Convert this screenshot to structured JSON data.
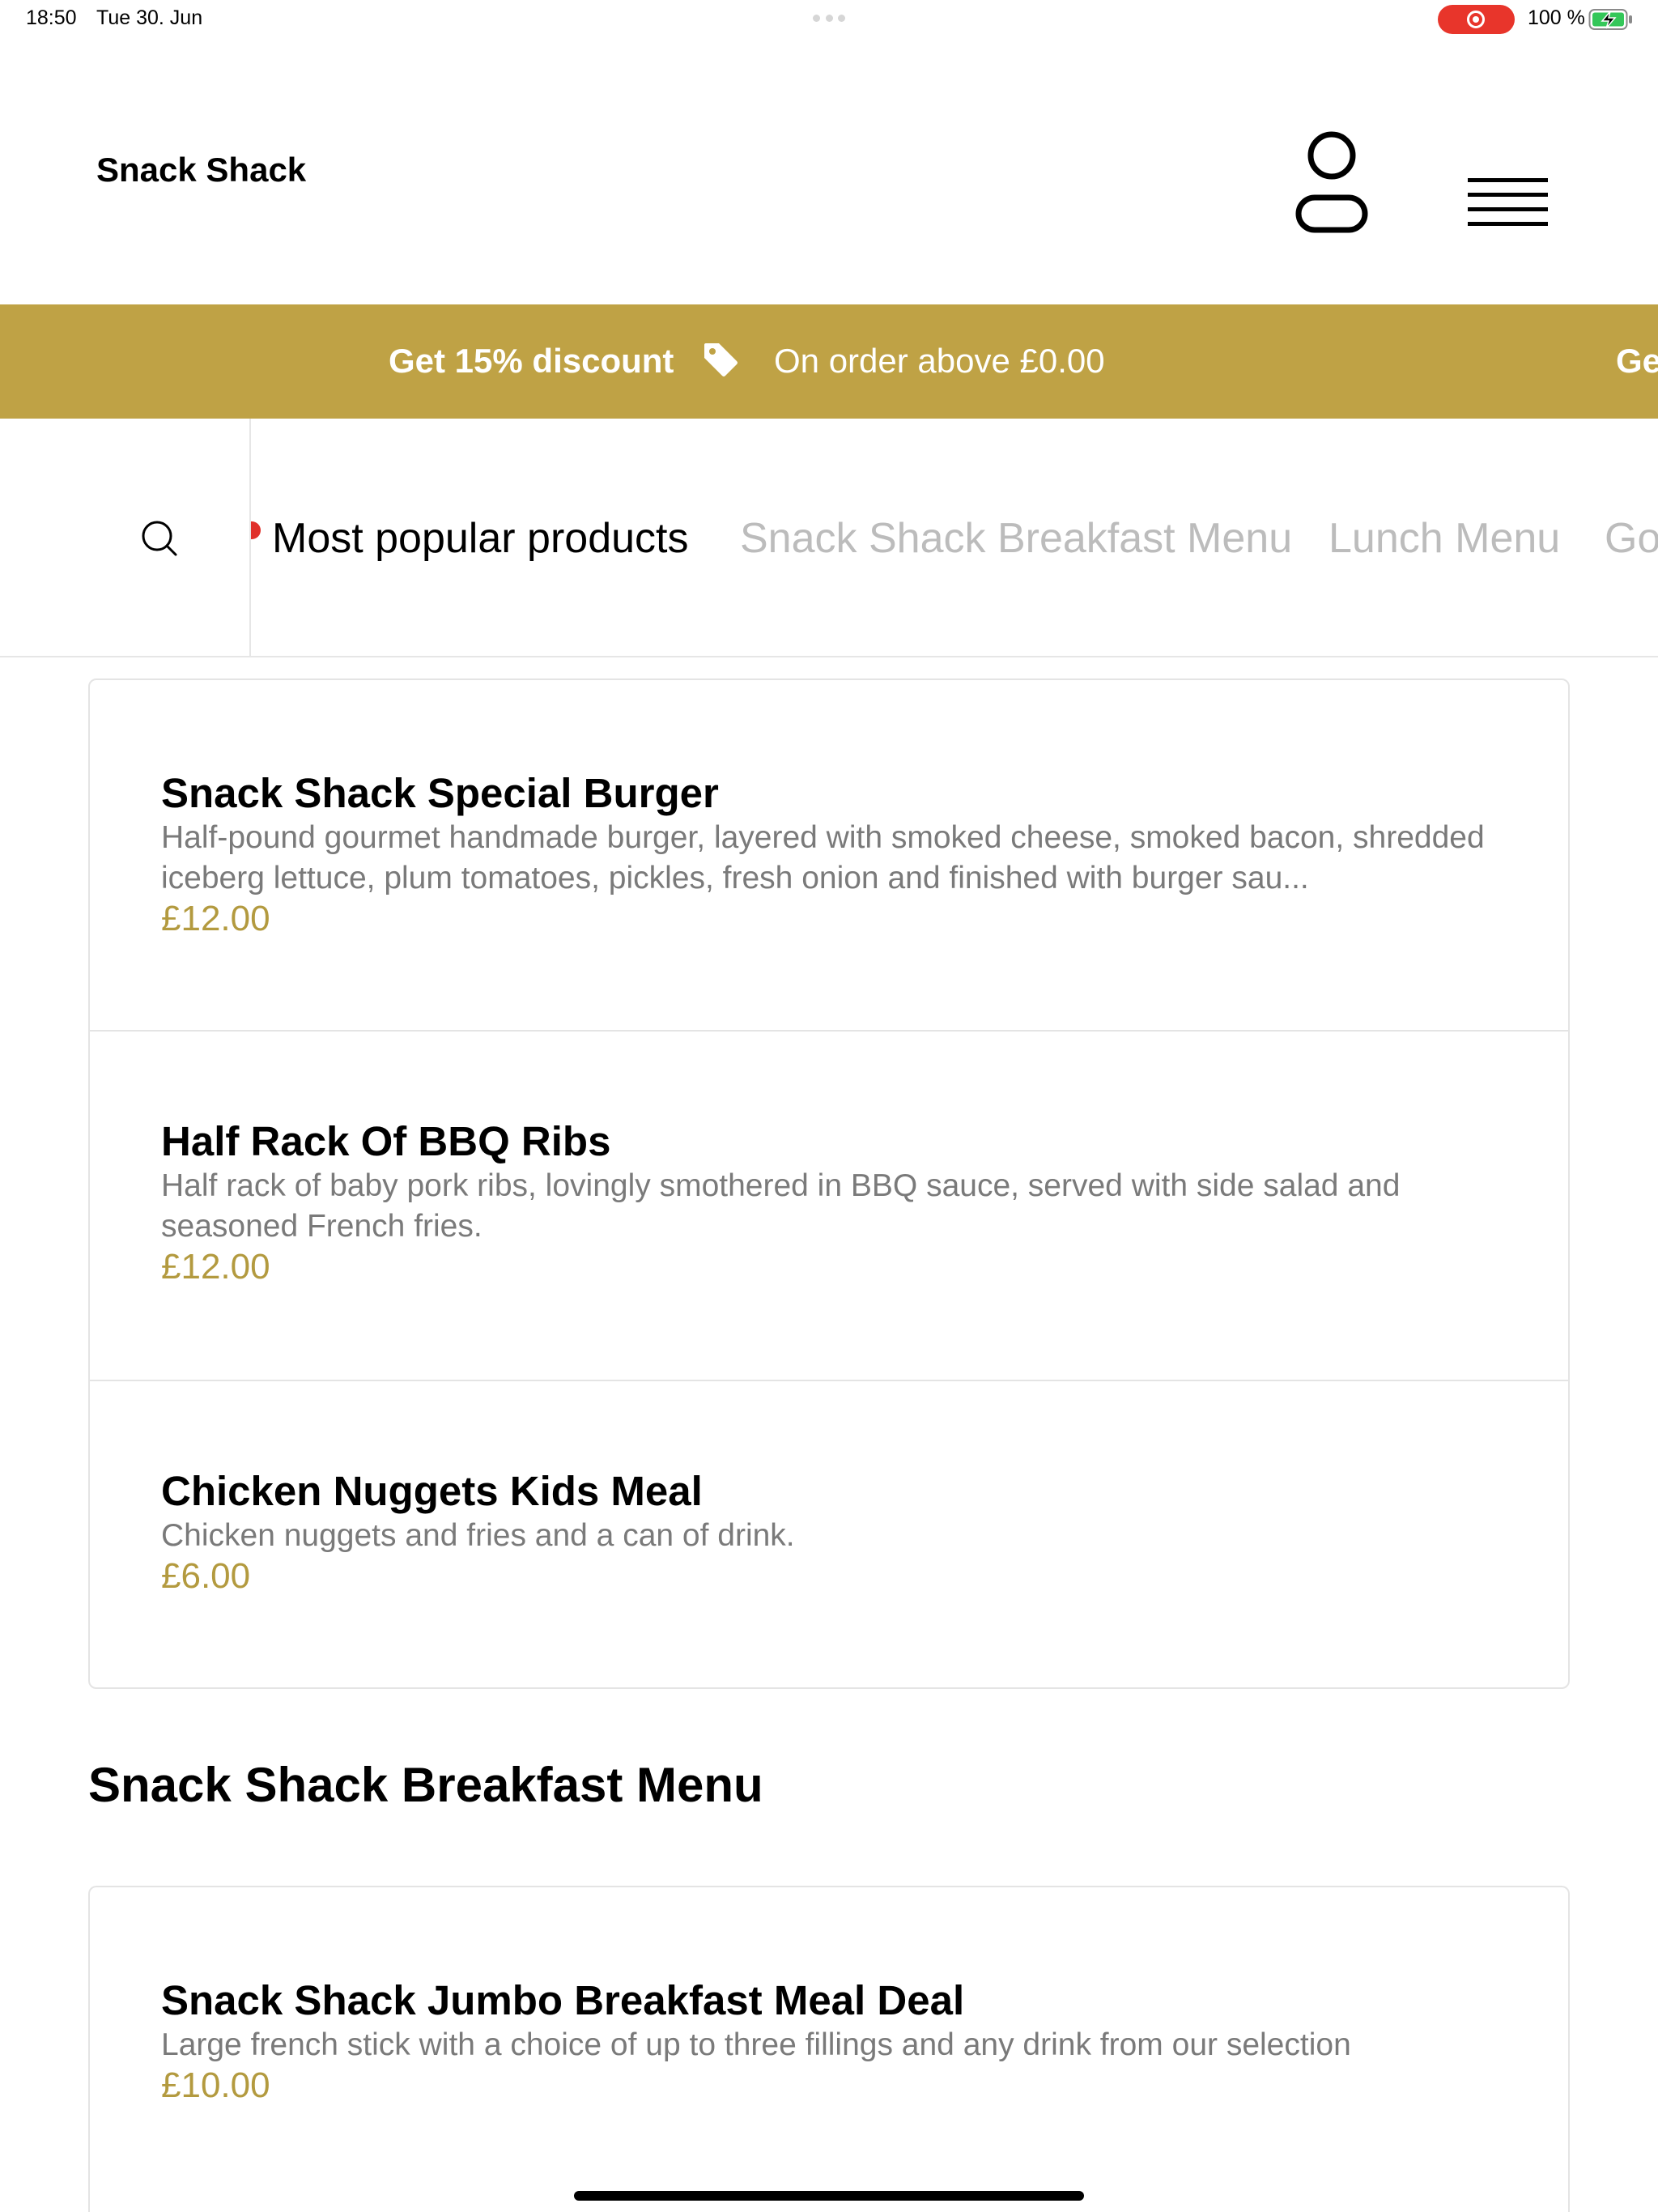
{
  "status_bar": {
    "time": "18:50",
    "date": "Tue 30. Jun",
    "battery": "100 %"
  },
  "header": {
    "brand": "Snack Shack",
    "account_icon": "user-icon",
    "menu_icon": "hamburger-menu-icon"
  },
  "promo": {
    "title": "Get 15% discount",
    "subtitle": "On order above £0.00",
    "repeat_fragment": "Ge",
    "icon": "tag-icon",
    "color": "#bfa245"
  },
  "categories": {
    "search_icon": "search-icon",
    "tabs": [
      {
        "label": "Most popular products",
        "active": true
      },
      {
        "label": "Snack Shack Breakfast Menu",
        "active": false
      },
      {
        "label": "Lunch Menu",
        "active": false
      },
      {
        "label": "Go",
        "active": false
      }
    ]
  },
  "popular": {
    "items": [
      {
        "name": "Snack Shack Special Burger",
        "description": "Half-pound gourmet handmade burger, layered with smoked cheese, smoked bacon, shredded iceberg lettuce, plum tomatoes, pickles, fresh onion and finished with burger sau...",
        "price": "£12.00"
      },
      {
        "name": "Half Rack Of BBQ Ribs",
        "description": "Half rack of baby pork ribs, lovingly smothered in BBQ sauce, served with side salad and seasoned French fries.",
        "price": "£12.00"
      },
      {
        "name": "Chicken Nuggets Kids Meal",
        "description": "Chicken nuggets and fries and a can of drink.",
        "price": "£6.00"
      }
    ]
  },
  "breakfast": {
    "heading": "Snack Shack Breakfast Menu",
    "items": [
      {
        "name": "Snack Shack Jumbo Breakfast Meal Deal",
        "description": "Large french stick with a choice of up to three fillings and any drink from our selection",
        "price": "£10.00"
      }
    ]
  },
  "colors": {
    "accent": "#bfa245",
    "price": "#b39a3f",
    "record": "#e8352b"
  }
}
